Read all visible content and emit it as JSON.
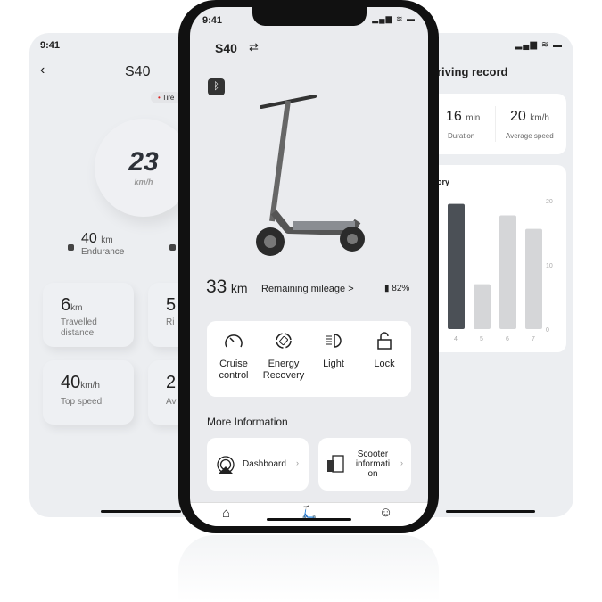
{
  "left_screen": {
    "time": "9:41",
    "title": "S40",
    "tire_badge": "Tire",
    "speed": "23",
    "speed_unit": "km/h",
    "endurance": {
      "value": "40",
      "unit": "km",
      "label": "Endurance"
    },
    "tiles": [
      {
        "value": "6",
        "unit": "km",
        "label": "Travelled distance"
      },
      {
        "value": "5",
        "label": "Ri"
      },
      {
        "value": "40",
        "unit": "km/h",
        "label": "Top speed"
      },
      {
        "value": "2",
        "label": "Av"
      }
    ]
  },
  "right_screen": {
    "title": "riving record",
    "duration": {
      "value": "16",
      "unit": "min",
      "label": "Duration"
    },
    "avg_speed": {
      "value": "20",
      "unit": "km/h",
      "label": "Average speed"
    },
    "history_title": "ory"
  },
  "chart_data": {
    "type": "bar",
    "categories": [
      "4",
      "5",
      "6",
      "7"
    ],
    "values": [
      19.5,
      7,
      17.7,
      15.6
    ],
    "highlight": "4",
    "ylim": [
      0,
      20
    ],
    "yticks": [
      "0",
      "10",
      "20"
    ],
    "colors": {
      "highlight": "#4b5056",
      "other": "#d5d6d8"
    }
  },
  "main_screen": {
    "time": "9:41",
    "title": "S40",
    "remaining": {
      "value": "33",
      "unit": "km",
      "label": "Remaining mileage >"
    },
    "battery": "82%",
    "controls": [
      {
        "label": "Cruise control",
        "icon": "speedometer-icon"
      },
      {
        "label": "Energy Recovery",
        "icon": "energy-recovery-icon"
      },
      {
        "label": "Light",
        "icon": "headlight-icon"
      },
      {
        "label": "Lock",
        "icon": "unlock-icon"
      }
    ],
    "more_info_title": "More Information",
    "dashboard": "Dashboard",
    "scooter_info": "Scooter informati on",
    "nav": [
      "store-icon",
      "scooter-icon",
      "profile-icon"
    ]
  }
}
